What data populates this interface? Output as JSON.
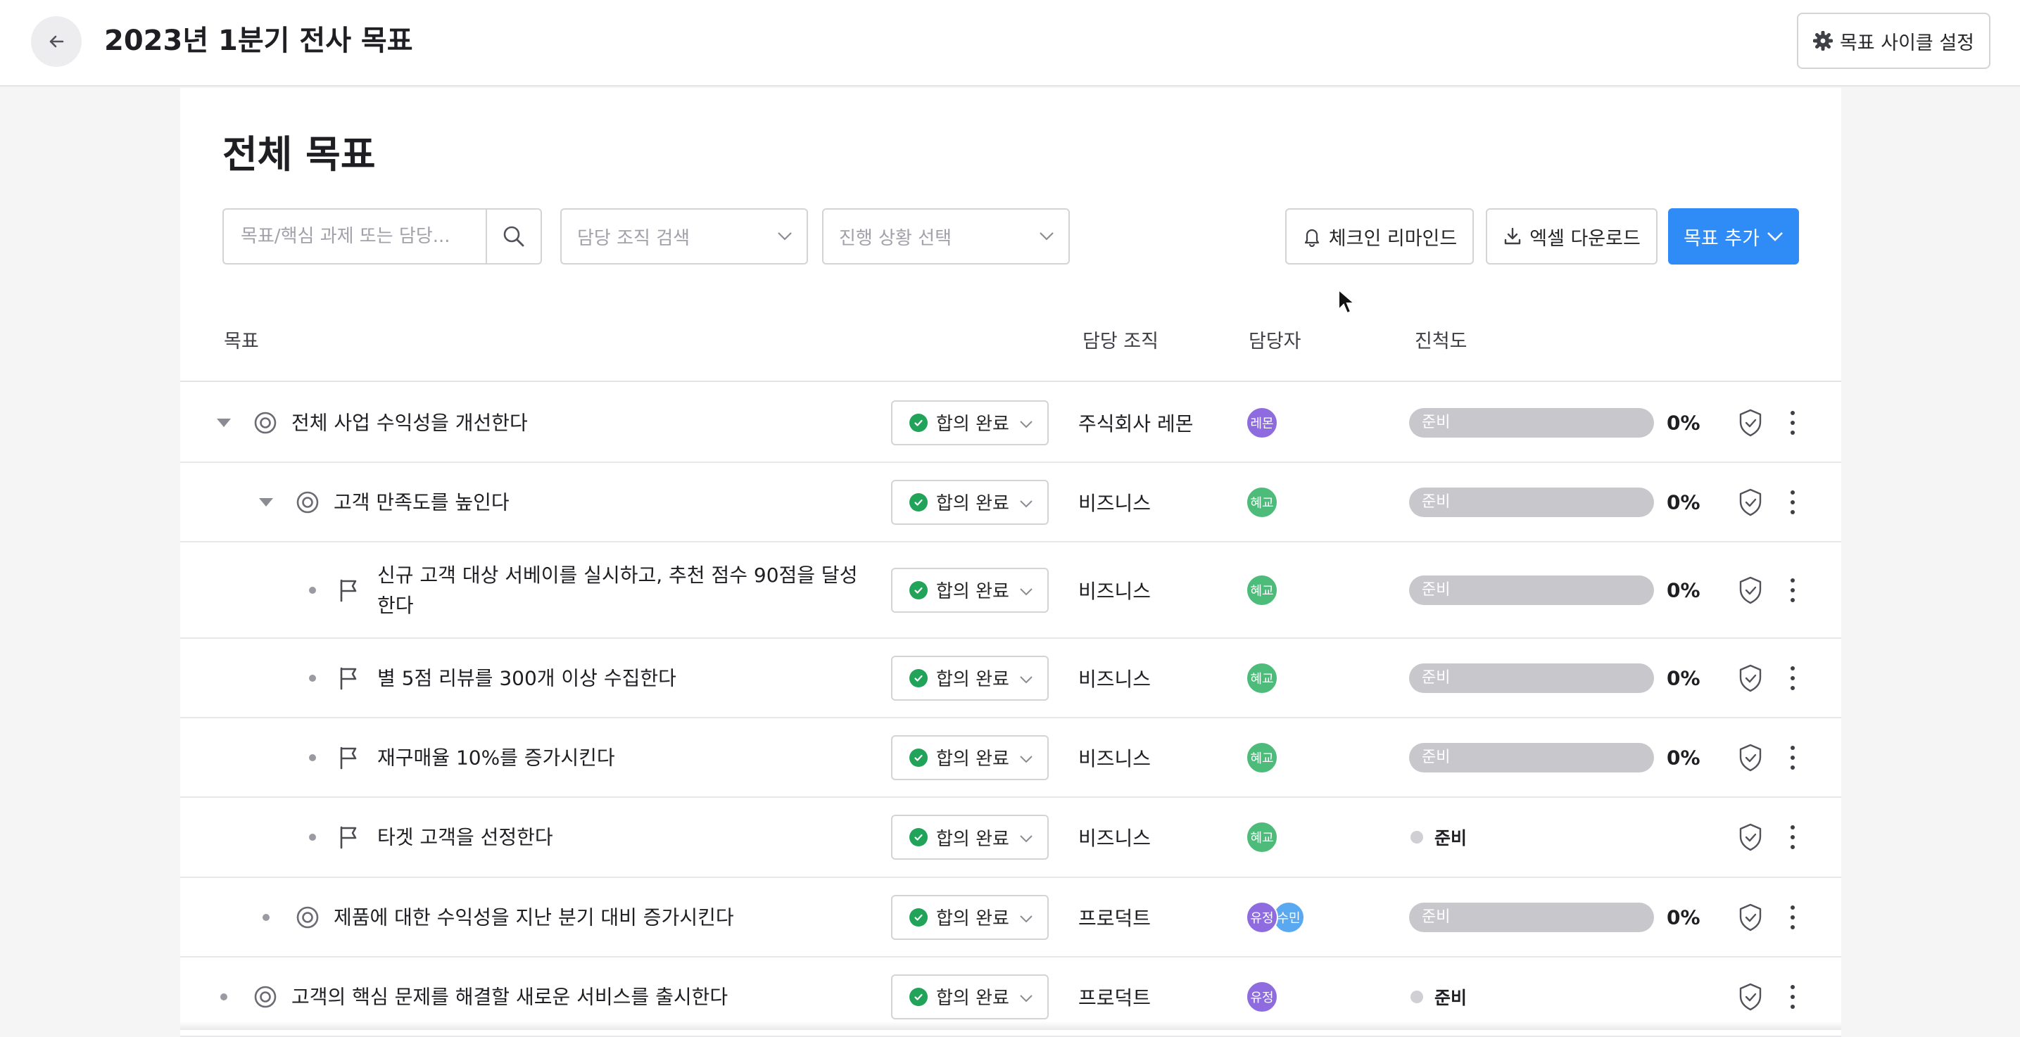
{
  "header": {
    "title": "2023년 1분기 전사 목표",
    "cycle_settings_label": "목표 사이클 설정"
  },
  "main": {
    "section_title": "전체 목표",
    "search": {
      "placeholder": "목표/핵심 과제 또는 담당..."
    },
    "org_filter": {
      "placeholder": "담당 조직 검색"
    },
    "status_filter": {
      "placeholder": "진행 상황 선택"
    },
    "reminder_label": "체크인 리마인드",
    "excel_label": "엑셀 다운로드",
    "add_goal_label": "목표 추가"
  },
  "table": {
    "headers": {
      "goal": "목표",
      "org": "담당 조직",
      "owner": "담당자",
      "progress": "진척도"
    },
    "rows": [
      {
        "title": "전체 사업 수익성을 개선한다",
        "type": "objective",
        "status": "합의 완료",
        "org": "주식회사 레몬",
        "owners": [
          "레몬"
        ],
        "progress_label": "준비",
        "progress": "0%",
        "has_bar": true
      },
      {
        "title": "고객 만족도를 높인다",
        "type": "objective",
        "status": "합의 완료",
        "org": "비즈니스",
        "owners": [
          "혜교"
        ],
        "progress_label": "준비",
        "progress": "0%",
        "has_bar": true
      },
      {
        "title": "신규 고객 대상 서베이를 실시하고, 추천 점수 90점을 달성한다",
        "title_line1": "신규 고객 대상 서베이를 실시하고, 추천 점수 90점을 달성",
        "title_line2": "한다",
        "type": "key-result",
        "status": "합의 완료",
        "org": "비즈니스",
        "owners": [
          "혜교"
        ],
        "progress_label": "준비",
        "progress": "0%",
        "has_bar": true
      },
      {
        "title": "별 5점 리뷰를 300개 이상 수집한다",
        "type": "key-result",
        "status": "합의 완료",
        "org": "비즈니스",
        "owners": [
          "혜교"
        ],
        "progress_label": "준비",
        "progress": "0%",
        "has_bar": true
      },
      {
        "title": "재구매율 10%를 증가시킨다",
        "type": "key-result",
        "status": "합의 완료",
        "org": "비즈니스",
        "owners": [
          "혜교"
        ],
        "progress_label": "준비",
        "progress": "0%",
        "has_bar": true
      },
      {
        "title": "타겟 고객을 선정한다",
        "type": "key-result",
        "status": "합의 완료",
        "org": "비즈니스",
        "owners": [
          "혜교"
        ],
        "progress_label": "준비",
        "has_bar": false
      },
      {
        "title": "제품에 대한 수익성을 지난 분기 대비 증가시킨다",
        "type": "objective",
        "status": "합의 완료",
        "org": "프로덕트",
        "owners": [
          "유정",
          "수민"
        ],
        "progress_label": "준비",
        "progress": "0%",
        "has_bar": true
      },
      {
        "title": "고객의 핵심 문제를 해결할 새로운 서비스를 출시한다",
        "type": "objective",
        "status": "합의 완료",
        "org": "프로덕트",
        "owners": [
          "유정"
        ],
        "progress_label": "준비",
        "has_bar": false
      }
    ]
  },
  "colors": {
    "primary": "#2f8cf6",
    "status_green": "#22a35a",
    "avatar_purple": "#8e6ce0",
    "avatar_green": "#4dbb7a",
    "avatar_blue": "#5aa8f0",
    "progress_gray": "#c8c8cc"
  }
}
